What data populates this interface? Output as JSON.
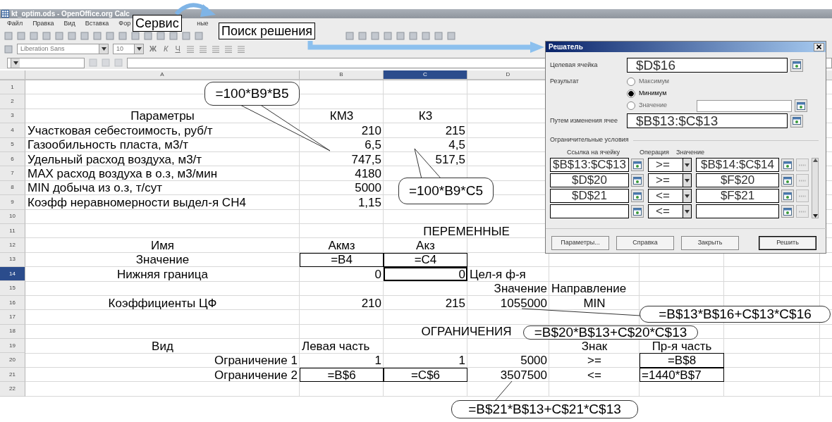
{
  "window": {
    "title": "kt_optim.ods - OpenOffice.org Calc"
  },
  "menu": [
    "Файл",
    "Правка",
    "Вид",
    "Вставка",
    "Фор",
    "ные"
  ],
  "format_bar": {
    "font": "Liberation Sans",
    "size": "10",
    "styles": [
      "Ж",
      "К",
      "Ч"
    ]
  },
  "columns": [
    {
      "label": "A",
      "selected": false
    },
    {
      "label": "B",
      "selected": false
    },
    {
      "label": "C",
      "selected": true
    },
    {
      "label": "D",
      "selected": false
    }
  ],
  "rows": [
    {
      "number": "1",
      "selected": false,
      "cells": []
    },
    {
      "number": "2",
      "selected": false,
      "cells": []
    },
    {
      "number": "3",
      "selected": false,
      "cells": [
        {
          "text": "Параметры",
          "boxed": false
        },
        {
          "text": "КМ3",
          "boxed": false
        },
        {
          "text": "К3",
          "boxed": false
        }
      ]
    },
    {
      "number": "4",
      "selected": false,
      "cells": [
        {
          "text": "Участковая себестоимость, руб/т",
          "boxed": false
        },
        {
          "text": "210",
          "boxed": false
        },
        {
          "text": "215",
          "boxed": false
        }
      ]
    },
    {
      "number": "5",
      "selected": false,
      "cells": [
        {
          "text": "Газообильность пласта, м3/т",
          "boxed": false
        },
        {
          "text": "6,5",
          "boxed": false
        },
        {
          "text": "4,5",
          "boxed": false
        }
      ]
    },
    {
      "number": "6",
      "selected": false,
      "cells": [
        {
          "text": "Удельный расход воздуха, м3/т",
          "boxed": false
        },
        {
          "text": "747,5",
          "boxed": false
        },
        {
          "text": "517,5",
          "boxed": false
        }
      ]
    },
    {
      "number": "7",
      "selected": false,
      "cells": [
        {
          "text": "MAX расход воздуха в о.з, м3/мин",
          "boxed": false
        },
        {
          "text": "4180",
          "boxed": false
        }
      ]
    },
    {
      "number": "8",
      "selected": false,
      "cells": [
        {
          "text": "MIN добыча из о.з, т/сут",
          "boxed": false
        },
        {
          "text": "5000",
          "boxed": false
        }
      ]
    },
    {
      "number": "9",
      "selected": false,
      "cells": [
        {
          "text": "Коэфф неравномерности выдел-я CH4",
          "boxed": false
        },
        {
          "text": "1,15",
          "boxed": false
        }
      ]
    },
    {
      "number": "10",
      "selected": false,
      "cells": []
    },
    {
      "number": "11",
      "selected": false,
      "section": "ПЕРЕМЕННЫЕ",
      "cells": []
    },
    {
      "number": "12",
      "selected": false,
      "cells": [
        {
          "text": "Имя",
          "boxed": false
        },
        {
          "text": "Акмз",
          "boxed": false
        },
        {
          "text": "Акз",
          "boxed": false
        }
      ]
    },
    {
      "number": "13",
      "selected": false,
      "cells": [
        {
          "text": "Значение",
          "boxed": false
        },
        {
          "text": "=B4",
          "boxed": true
        },
        {
          "text": "=C4",
          "boxed": true
        }
      ]
    },
    {
      "number": "14",
      "selected": true,
      "cells": [
        {
          "text": "Нижняя граница",
          "boxed": false
        },
        {
          "text": "0",
          "boxed": false
        },
        {
          "text": "0",
          "boxed": false
        },
        {
          "text": "Цел-я ф-я",
          "boxed": false
        }
      ]
    },
    {
      "number": "15",
      "selected": false,
      "cells": [
        null,
        null,
        null,
        {
          "text": "Значение",
          "boxed": false
        },
        {
          "text": "Направление",
          "boxed": false
        }
      ]
    },
    {
      "number": "16",
      "selected": false,
      "cells": [
        {
          "text": "Коэффициенты ЦФ",
          "boxed": false
        },
        {
          "text": "210",
          "boxed": false
        },
        {
          "text": "215",
          "boxed": false
        },
        {
          "text": "1055000",
          "boxed": false
        },
        {
          "text": "MIN",
          "boxed": false
        }
      ]
    },
    {
      "number": "17",
      "selected": false,
      "cells": []
    },
    {
      "number": "18",
      "selected": false,
      "section": "ОГРАНИЧЕНИЯ",
      "cells": []
    },
    {
      "number": "19",
      "selected": false,
      "cells": [
        {
          "text": "Вид",
          "boxed": false
        },
        {
          "text": "Левая часть",
          "boxed": false
        },
        null,
        null,
        {
          "text": "Знак",
          "boxed": false
        },
        {
          "text": "Пр-я часть",
          "boxed": false
        }
      ]
    },
    {
      "number": "20",
      "selected": false,
      "cells": [
        {
          "text": "Ограничение 1",
          "boxed": false
        },
        {
          "text": "1",
          "boxed": false
        },
        {
          "text": "1",
          "boxed": false
        },
        {
          "text": "5000",
          "boxed": false
        },
        {
          "text": ">=",
          "boxed": false
        },
        {
          "text": "=B$8",
          "boxed": true
        }
      ]
    },
    {
      "number": "21",
      "selected": false,
      "cells": [
        {
          "text": "Ограничение 2",
          "boxed": false
        },
        {
          "text": "=B$6",
          "boxed": true
        },
        {
          "text": "=C$6",
          "boxed": true
        },
        {
          "text": "3507500",
          "boxed": false
        },
        {
          "text": "<=",
          "boxed": false
        },
        {
          "text": "=1440*B$7",
          "boxed": true
        }
      ]
    },
    {
      "number": "22",
      "selected": false,
      "cells": []
    }
  ],
  "dialog": {
    "title": "Решатель",
    "target": {
      "label": "Целевая ячейка",
      "value": "$D$16"
    },
    "result": {
      "label": "Результат",
      "options": [
        {
          "label": "Максимум",
          "selected": false,
          "kind": "plain"
        },
        {
          "label": "Минимум",
          "selected": true,
          "kind": "plain"
        },
        {
          "label": "Значение",
          "selected": false,
          "kind": "with-field"
        }
      ]
    },
    "changing": {
      "label": "Путем изменения ячее",
      "value": "$B$13:$C$13"
    },
    "constraints": {
      "title": "Ограничительные условия",
      "headers": [
        "Ссылка на ячейку",
        "Операция",
        "Значение"
      ],
      "rows": [
        {
          "reference": "$B$13:$C$13",
          "operator": ">=",
          "value": "$B$14:$C$14"
        },
        {
          "reference": "$D$20",
          "operator": ">=",
          "value": "$F$20"
        },
        {
          "reference": "$D$21",
          "operator": "<=",
          "value": "$F$21"
        },
        {
          "operator": "<="
        }
      ]
    },
    "buttons": [
      {
        "label": "Параметры...",
        "default": false
      },
      {
        "label": "Справка",
        "default": false
      },
      {
        "label": "Закрыть",
        "default": false
      },
      {
        "label": "Решить",
        "default": true
      }
    ]
  },
  "menu_callouts": [
    "Сервис",
    "Поиск решения"
  ],
  "callouts": [
    {
      "text": "=100*B9*B5"
    },
    {
      "text": "=100*B9*C5"
    },
    {
      "text": "=B$13*B$16+C$13*C$16"
    },
    {
      "text": "=B$20*B$13+C$20*C$13"
    },
    {
      "text": "=B$21*B$13+C$21*C$13"
    }
  ]
}
